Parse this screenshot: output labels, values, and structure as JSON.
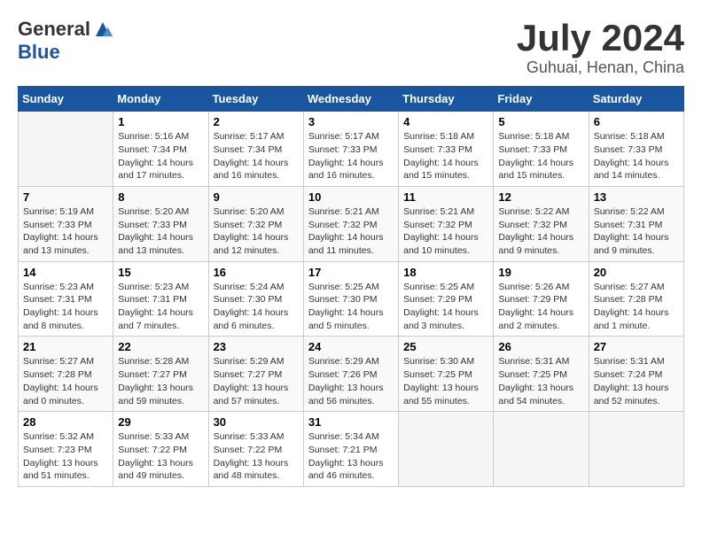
{
  "header": {
    "logo_general": "General",
    "logo_blue": "Blue",
    "title": "July 2024",
    "location": "Guhuai, Henan, China"
  },
  "days_of_week": [
    "Sunday",
    "Monday",
    "Tuesday",
    "Wednesday",
    "Thursday",
    "Friday",
    "Saturday"
  ],
  "weeks": [
    [
      {
        "day": "",
        "empty": true
      },
      {
        "day": "1",
        "sunrise": "5:16 AM",
        "sunset": "7:34 PM",
        "daylight": "14 hours and 17 minutes."
      },
      {
        "day": "2",
        "sunrise": "5:17 AM",
        "sunset": "7:34 PM",
        "daylight": "14 hours and 16 minutes."
      },
      {
        "day": "3",
        "sunrise": "5:17 AM",
        "sunset": "7:33 PM",
        "daylight": "14 hours and 16 minutes."
      },
      {
        "day": "4",
        "sunrise": "5:18 AM",
        "sunset": "7:33 PM",
        "daylight": "14 hours and 15 minutes."
      },
      {
        "day": "5",
        "sunrise": "5:18 AM",
        "sunset": "7:33 PM",
        "daylight": "14 hours and 15 minutes."
      },
      {
        "day": "6",
        "sunrise": "5:18 AM",
        "sunset": "7:33 PM",
        "daylight": "14 hours and 14 minutes."
      }
    ],
    [
      {
        "day": "7",
        "sunrise": "5:19 AM",
        "sunset": "7:33 PM",
        "daylight": "14 hours and 13 minutes."
      },
      {
        "day": "8",
        "sunrise": "5:20 AM",
        "sunset": "7:33 PM",
        "daylight": "14 hours and 13 minutes."
      },
      {
        "day": "9",
        "sunrise": "5:20 AM",
        "sunset": "7:32 PM",
        "daylight": "14 hours and 12 minutes."
      },
      {
        "day": "10",
        "sunrise": "5:21 AM",
        "sunset": "7:32 PM",
        "daylight": "14 hours and 11 minutes."
      },
      {
        "day": "11",
        "sunrise": "5:21 AM",
        "sunset": "7:32 PM",
        "daylight": "14 hours and 10 minutes."
      },
      {
        "day": "12",
        "sunrise": "5:22 AM",
        "sunset": "7:32 PM",
        "daylight": "14 hours and 9 minutes."
      },
      {
        "day": "13",
        "sunrise": "5:22 AM",
        "sunset": "7:31 PM",
        "daylight": "14 hours and 9 minutes."
      }
    ],
    [
      {
        "day": "14",
        "sunrise": "5:23 AM",
        "sunset": "7:31 PM",
        "daylight": "14 hours and 8 minutes."
      },
      {
        "day": "15",
        "sunrise": "5:23 AM",
        "sunset": "7:31 PM",
        "daylight": "14 hours and 7 minutes."
      },
      {
        "day": "16",
        "sunrise": "5:24 AM",
        "sunset": "7:30 PM",
        "daylight": "14 hours and 6 minutes."
      },
      {
        "day": "17",
        "sunrise": "5:25 AM",
        "sunset": "7:30 PM",
        "daylight": "14 hours and 5 minutes."
      },
      {
        "day": "18",
        "sunrise": "5:25 AM",
        "sunset": "7:29 PM",
        "daylight": "14 hours and 3 minutes."
      },
      {
        "day": "19",
        "sunrise": "5:26 AM",
        "sunset": "7:29 PM",
        "daylight": "14 hours and 2 minutes."
      },
      {
        "day": "20",
        "sunrise": "5:27 AM",
        "sunset": "7:28 PM",
        "daylight": "14 hours and 1 minute."
      }
    ],
    [
      {
        "day": "21",
        "sunrise": "5:27 AM",
        "sunset": "7:28 PM",
        "daylight": "14 hours and 0 minutes."
      },
      {
        "day": "22",
        "sunrise": "5:28 AM",
        "sunset": "7:27 PM",
        "daylight": "13 hours and 59 minutes."
      },
      {
        "day": "23",
        "sunrise": "5:29 AM",
        "sunset": "7:27 PM",
        "daylight": "13 hours and 57 minutes."
      },
      {
        "day": "24",
        "sunrise": "5:29 AM",
        "sunset": "7:26 PM",
        "daylight": "13 hours and 56 minutes."
      },
      {
        "day": "25",
        "sunrise": "5:30 AM",
        "sunset": "7:25 PM",
        "daylight": "13 hours and 55 minutes."
      },
      {
        "day": "26",
        "sunrise": "5:31 AM",
        "sunset": "7:25 PM",
        "daylight": "13 hours and 54 minutes."
      },
      {
        "day": "27",
        "sunrise": "5:31 AM",
        "sunset": "7:24 PM",
        "daylight": "13 hours and 52 minutes."
      }
    ],
    [
      {
        "day": "28",
        "sunrise": "5:32 AM",
        "sunset": "7:23 PM",
        "daylight": "13 hours and 51 minutes."
      },
      {
        "day": "29",
        "sunrise": "5:33 AM",
        "sunset": "7:22 PM",
        "daylight": "13 hours and 49 minutes."
      },
      {
        "day": "30",
        "sunrise": "5:33 AM",
        "sunset": "7:22 PM",
        "daylight": "13 hours and 48 minutes."
      },
      {
        "day": "31",
        "sunrise": "5:34 AM",
        "sunset": "7:21 PM",
        "daylight": "13 hours and 46 minutes."
      },
      {
        "day": "",
        "empty": true
      },
      {
        "day": "",
        "empty": true
      },
      {
        "day": "",
        "empty": true
      }
    ]
  ],
  "labels": {
    "sunrise": "Sunrise:",
    "sunset": "Sunset:",
    "daylight": "Daylight:"
  }
}
